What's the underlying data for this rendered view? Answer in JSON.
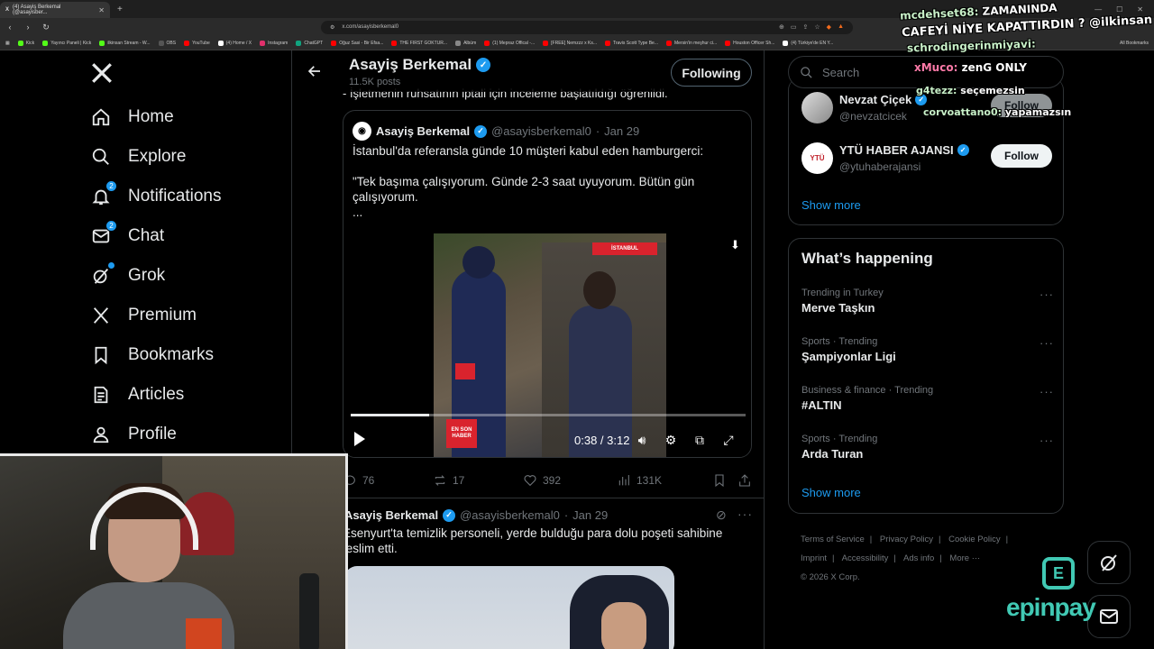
{
  "browser": {
    "tab_title": "(4) Asayiş Berkemal (@asayisber...",
    "url": "x.com/asayisberkemal0",
    "bookmarks": [
      "Kick",
      "Yayıncı Paneli | Kick",
      "ilkinsan Stream - W...",
      "OBS",
      "YouTube",
      "(4) Home / X",
      "Instagram",
      "ChatGPT",
      "Oğuz Sasi - Bir Efsa...",
      "THE FIRST GOKTUR...",
      "Albüm",
      "(1) Mepraz Offical -...",
      "[FREE] Nemzzz x Ks...",
      "Travis Scott Type Be...",
      "Mersin'in meşhur ci...",
      "Houston Officer Sh...",
      "(4) Türkiye'de EN Y..."
    ],
    "all_bookmarks": "All Bookmarks"
  },
  "nav": {
    "items": [
      {
        "label": "Home"
      },
      {
        "label": "Explore"
      },
      {
        "label": "Notifications",
        "badge": "2"
      },
      {
        "label": "Chat",
        "badge": "2"
      },
      {
        "label": "Grok"
      },
      {
        "label": "Premium"
      },
      {
        "label": "Bookmarks"
      },
      {
        "label": "Articles"
      },
      {
        "label": "Profile"
      }
    ]
  },
  "header": {
    "name": "Asayiş Berkemal",
    "posts": "11.5K posts",
    "following_label": "Following"
  },
  "post1": {
    "cut_text": "- İşletmenin ruhsatının iptali için inceleme başlatıldığı öğrenildi.",
    "quote": {
      "name": "Asayiş Berkemal",
      "handle": "@asayisberkemal0",
      "dot": "·",
      "date": "Jan 29",
      "line1": "İstanbul'da referansla günde 10 müşteri kabul eden hamburgerci:",
      "line2": "\"Tek başıma çalışıyorum. Günde 2-3 saat uyuyorum. Bütün gün çalışıyorum.",
      "line3": "..."
    },
    "video": {
      "overlay_tr": "İSTANBUL",
      "overlay_bl": "EN SON HABER",
      "time": "0:38 / 3:12",
      "progress": 0.198
    },
    "stats": {
      "replies": "76",
      "reposts": "17",
      "likes": "392",
      "views": "131K"
    }
  },
  "post2": {
    "name": "Asayiş Berkemal",
    "handle": "@asayisberkemal0",
    "dot": "·",
    "date": "Jan 29",
    "text": "Esenyurt'ta temizlik personeli, yerde bulduğu para dolu poşeti sahibine teslim etti."
  },
  "sidebar": {
    "search_placeholder": "Search",
    "who_to_follow": [
      {
        "name": "Nevzat Çiçek",
        "handle": "@nevzatcicek",
        "button": "Follow"
      },
      {
        "name": "YTÜ HABER AJANSI",
        "handle": "@ytuhaberajansi",
        "button": "Follow"
      }
    ],
    "show_more": "Show more",
    "trends_title": "What’s happening",
    "trends": [
      {
        "meta": "Trending in Turkey",
        "name": "Merve Taşkın"
      },
      {
        "meta": "Sports · Trending",
        "name": "Şampiyonlar Ligi"
      },
      {
        "meta": "Business & finance · Trending",
        "name": "#ALTIN"
      },
      {
        "meta": "Sports · Trending",
        "name": "Arda Turan"
      }
    ],
    "trends_show_more": "Show more",
    "footer": [
      "Terms of Service",
      "Privacy Policy",
      "Cookie Policy",
      "Imprint",
      "Accessibility",
      "Ads info",
      "More ···",
      "© 2026 X Corp."
    ]
  },
  "stream_chat": [
    {
      "user": "mcdehset68:",
      "msg": "ZAMANINDA"
    },
    {
      "user": "",
      "msg": "CAFEYİ NİYE KAPATTIRDIN ? @ilkinsan"
    },
    {
      "user": "schrodingerinmiyavi:",
      "msg": ""
    },
    {
      "user": "xMuco:",
      "msg": "zenG ONLY"
    },
    {
      "user": "g4tezz:",
      "msg": "seçemezsin"
    },
    {
      "user": "corvoattano0:",
      "msg": "yapamazsın"
    }
  ],
  "sponsor": {
    "text": "epinpay",
    "icon_letter": "E"
  },
  "colors": {
    "accent": "#1d9bf0",
    "background": "#000000",
    "sponsor": "#41c9b4"
  }
}
